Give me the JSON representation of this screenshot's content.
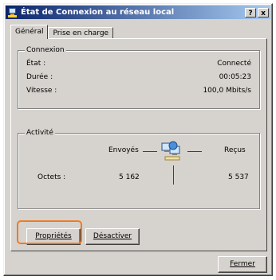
{
  "window": {
    "title": "État de Connexion au réseau local",
    "help_label": "?",
    "close_label": "x"
  },
  "tabs": [
    {
      "label": "Général"
    },
    {
      "label": "Prise en charge"
    }
  ],
  "connection": {
    "group_label": "Connexion",
    "rows": [
      {
        "label": "État :",
        "value": "Connecté"
      },
      {
        "label": "Durée :",
        "value": "00:05:23"
      },
      {
        "label": "Vitesse :",
        "value": "100,0 Mbits/s"
      }
    ]
  },
  "activity": {
    "group_label": "Activité",
    "sent_label": "Envoyés",
    "received_label": "Reçus",
    "bytes_label": "Octets :",
    "bytes_sent": "5 162",
    "bytes_received": "5 537"
  },
  "buttons": {
    "properties": "Propriétés",
    "disable": "Désactiver",
    "close": "Fermer"
  },
  "colors": {
    "titlebar_start": "#0a246a",
    "titlebar_end": "#a6caf0",
    "highlight": "#f47920",
    "face": "#d6d3ce"
  }
}
